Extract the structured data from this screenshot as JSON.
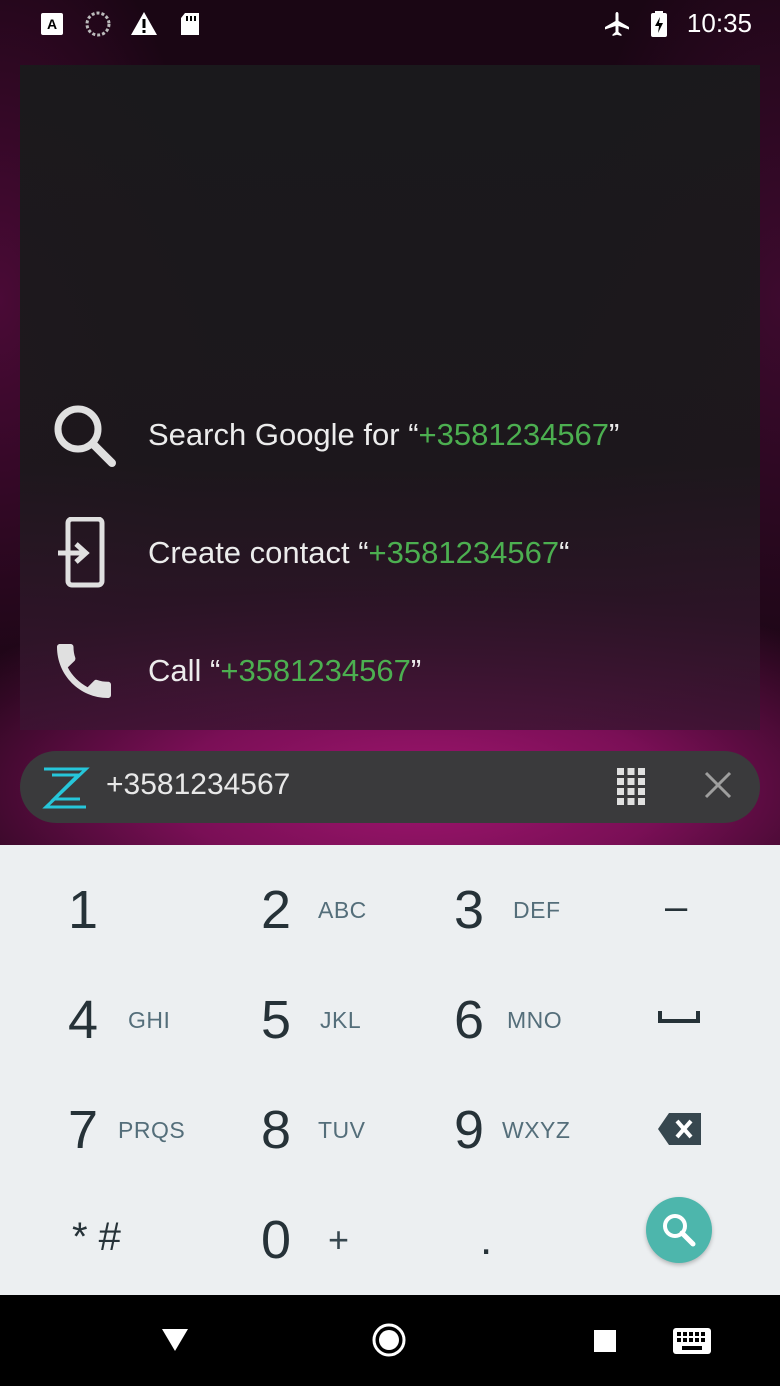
{
  "status_bar": {
    "time": "10:35",
    "left_icons": [
      "accessibility-icon",
      "sync-icon",
      "warning-icon",
      "sd-card-icon"
    ],
    "right_icons": [
      "airplane-icon",
      "battery-charging-icon"
    ]
  },
  "suggestions": [
    {
      "icon": "search-icon",
      "prefix": "Search Google for “",
      "number": "+3581234567",
      "suffix": "”"
    },
    {
      "icon": "create-contact-icon",
      "prefix": "Create contact “",
      "number": "+3581234567",
      "suffix": "“"
    },
    {
      "icon": "phone-icon",
      "prefix": "Call “",
      "number": "+3581234567",
      "suffix": "”"
    }
  ],
  "search_bar": {
    "query": "+3581234567",
    "logo": "z-logo-icon",
    "dialpad_icon": "dialpad-icon",
    "clear_icon": "close-icon"
  },
  "dialpad": {
    "keys": [
      {
        "digit": "1",
        "letters": ""
      },
      {
        "digit": "2",
        "letters": "ABC"
      },
      {
        "digit": "3",
        "letters": "DEF"
      },
      {
        "digit": "–",
        "letters": ""
      },
      {
        "digit": "4",
        "letters": "GHI"
      },
      {
        "digit": "5",
        "letters": "JKL"
      },
      {
        "digit": "6",
        "letters": "MNO"
      },
      {
        "digit": "␣",
        "letters": ""
      },
      {
        "digit": "7",
        "letters": "PRQS"
      },
      {
        "digit": "8",
        "letters": "TUV"
      },
      {
        "digit": "9",
        "letters": "WXYZ"
      },
      {
        "digit": "⌫",
        "letters": ""
      },
      {
        "digit": "* #",
        "letters": ""
      },
      {
        "digit": "0",
        "letters": "+"
      },
      {
        "digit": ".",
        "letters": ""
      }
    ],
    "fab_icon": "search-icon"
  },
  "nav_bar": {
    "icons": [
      "back-icon",
      "home-icon",
      "recents-icon",
      "keyboard-icon"
    ]
  },
  "colors": {
    "accent_number": "#4caf50",
    "fab": "#4db6ac",
    "wallpaper": "#a0156f",
    "logo": "#26c6da"
  }
}
